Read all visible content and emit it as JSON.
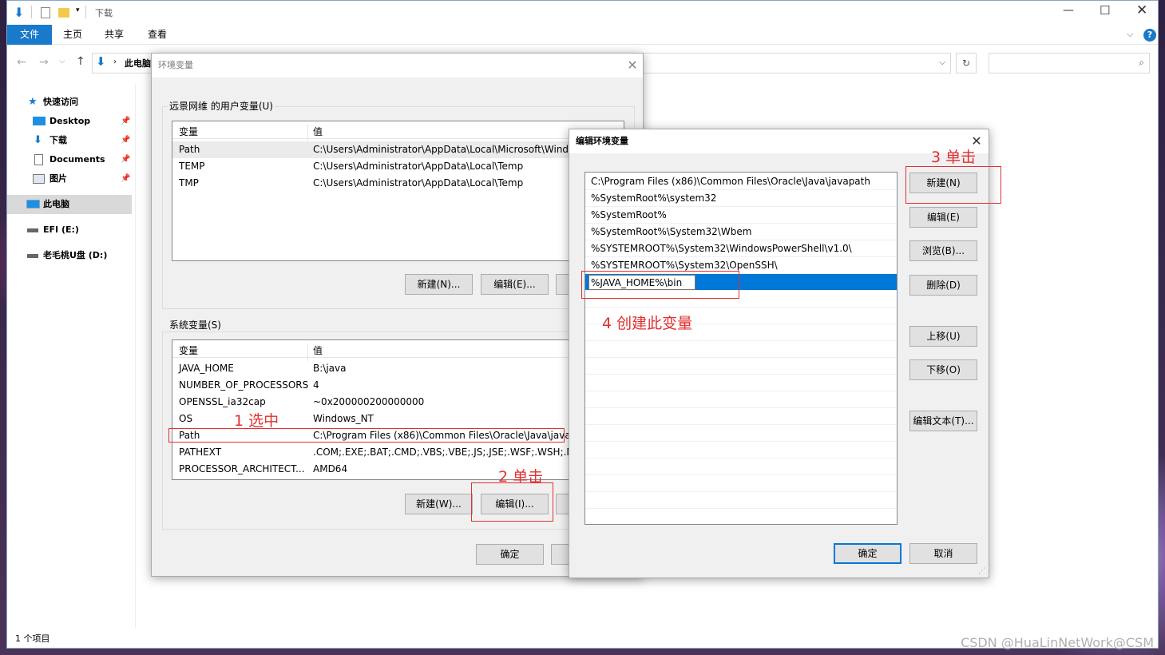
{
  "explorer": {
    "title": "下载",
    "ribbon_tabs": [
      "文件",
      "主页",
      "共享",
      "查看"
    ],
    "address": "此电脑",
    "nav": {
      "quick_access": "快速访问",
      "items": [
        "Desktop",
        "下载",
        "Documents",
        "图片"
      ],
      "this_pc": "此电脑",
      "drives": [
        "EFI (E:)",
        "老毛桃U盘 (D:)"
      ]
    },
    "status": "1 个项目"
  },
  "env_dialog": {
    "title": "环境变量",
    "user_group_label": "远景网维 的用户变量(U)",
    "col_var": "变量",
    "col_val": "值",
    "user_vars": [
      {
        "name": "Path",
        "value": "C:\\Users\\Administrator\\AppData\\Local\\Microsoft\\Windo"
      },
      {
        "name": "TEMP",
        "value": "C:\\Users\\Administrator\\AppData\\Local\\Temp"
      },
      {
        "name": "TMP",
        "value": "C:\\Users\\Administrator\\AppData\\Local\\Temp"
      }
    ],
    "user_new": "新建(N)...",
    "user_edit": "编辑(E)...",
    "sys_group_label": "系统变量(S)",
    "sys_vars": [
      {
        "name": "JAVA_HOME",
        "value": "B:\\java"
      },
      {
        "name": "NUMBER_OF_PROCESSORS",
        "value": "4"
      },
      {
        "name": "OPENSSL_ia32cap",
        "value": "~0x200000200000000"
      },
      {
        "name": "OS",
        "value": "Windows_NT"
      },
      {
        "name": "Path",
        "value": "C:\\Program Files (x86)\\Common Files\\Oracle\\Java\\javap"
      },
      {
        "name": "PATHEXT",
        "value": ".COM;.EXE;.BAT;.CMD;.VBS;.VBE;.JS;.JSE;.WSF;.WSH;.MSC"
      },
      {
        "name": "PROCESSOR_ARCHITECT...",
        "value": "AMD64"
      }
    ],
    "sys_new": "新建(W)...",
    "sys_edit": "编辑(I)...",
    "ok": "确定"
  },
  "edit_dialog": {
    "title": "编辑环境变量",
    "paths": [
      "C:\\Program Files (x86)\\Common Files\\Oracle\\Java\\javapath",
      "%SystemRoot%\\system32",
      "%SystemRoot%",
      "%SystemRoot%\\System32\\Wbem",
      "%SYSTEMROOT%\\System32\\WindowsPowerShell\\v1.0\\",
      "%SYSTEMROOT%\\System32\\OpenSSH\\"
    ],
    "editing_value": "%JAVA_HOME%\\bin",
    "buttons": {
      "new": "新建(N)",
      "edit": "编辑(E)",
      "browse": "浏览(B)...",
      "delete": "删除(D)",
      "move_up": "上移(U)",
      "move_down": "下移(O)",
      "edit_text": "编辑文本(T)..."
    },
    "ok": "确定",
    "cancel": "取消"
  },
  "annotations": {
    "a1": "1 选中",
    "a2": "2 单击",
    "a3": "3 单击",
    "a4": "4 创建此变量"
  },
  "watermark": "CSDN @HuaLinNetWork@CSM",
  "colors": {
    "accent": "#0078d7",
    "annotation": "#e03030",
    "file_tab": "#1979ca"
  }
}
